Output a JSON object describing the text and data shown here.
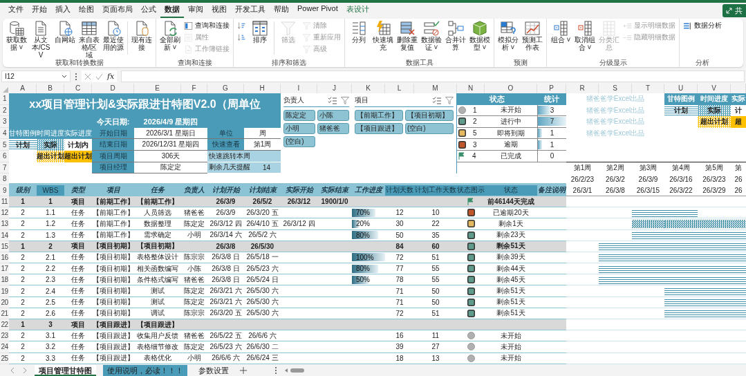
{
  "menu_tabs": [
    {
      "label": "文件",
      "selected": false,
      "kind": "standard"
    },
    {
      "label": "开始",
      "selected": false,
      "kind": "standard"
    },
    {
      "label": "插入",
      "selected": false,
      "kind": "standard"
    },
    {
      "label": "绘图",
      "selected": false,
      "kind": "standard"
    },
    {
      "label": "页面布局",
      "selected": false,
      "kind": "standard"
    },
    {
      "label": "公式",
      "selected": false,
      "kind": "standard"
    },
    {
      "label": "数据",
      "selected": true,
      "kind": "standard"
    },
    {
      "label": "审阅",
      "selected": false,
      "kind": "standard"
    },
    {
      "label": "视图",
      "selected": false,
      "kind": "standard"
    },
    {
      "label": "开发工具",
      "selected": false,
      "kind": "standard"
    },
    {
      "label": "帮助",
      "selected": false,
      "kind": "standard"
    },
    {
      "label": "Power Pivot",
      "selected": false,
      "kind": "standard"
    },
    {
      "label": "表设计",
      "selected": false,
      "kind": "contextual"
    }
  ],
  "share_button": {
    "label": "共"
  },
  "ribbon_groups": [
    {
      "label": "获取和转换数据",
      "items": [
        {
          "kind": "large",
          "label": "获取数据 ˅",
          "disabled": false
        },
        {
          "kind": "large",
          "label": "从文本/CSV",
          "disabled": false
        },
        {
          "kind": "large",
          "label": "自网站",
          "disabled": false
        },
        {
          "kind": "large",
          "label": "来自表格/区域",
          "disabled": false
        },
        {
          "kind": "large",
          "label": "最近使用的源",
          "disabled": false
        },
        {
          "kind": "divider"
        },
        {
          "kind": "large",
          "label": "现有连接",
          "disabled": false
        }
      ]
    },
    {
      "label": "查询和连接",
      "items": [
        {
          "kind": "large",
          "label": "全部刷新 ˅",
          "disabled": false
        },
        {
          "kind": "stack",
          "items": [
            {
              "label": "查询和连接",
              "disabled": false
            },
            {
              "label": "属性",
              "disabled": true
            },
            {
              "label": "工作簿链接",
              "disabled": true
            }
          ]
        }
      ]
    },
    {
      "label": "排序和筛选",
      "items": [
        {
          "kind": "stack",
          "items": [
            {
              "disabled": false
            },
            {
              "disabled": false
            }
          ]
        },
        {
          "kind": "large",
          "label": "排序",
          "disabled": false
        },
        {
          "kind": "divider"
        },
        {
          "kind": "large",
          "label": "筛选",
          "disabled": true
        },
        {
          "kind": "stack",
          "items": [
            {
              "label": "清除",
              "disabled": true
            },
            {
              "label": "重新应用",
              "disabled": true
            },
            {
              "label": "高级",
              "disabled": true
            }
          ]
        }
      ]
    },
    {
      "label": "数据工具",
      "items": [
        {
          "kind": "large",
          "label": "分列",
          "disabled": false
        },
        {
          "kind": "large",
          "label": "快速填充",
          "disabled": false
        },
        {
          "kind": "large",
          "label": "删除重复值",
          "disabled": false
        },
        {
          "kind": "large",
          "label": "数据验证 ˅",
          "disabled": false
        },
        {
          "kind": "large",
          "label": "合并计算",
          "disabled": false
        },
        {
          "kind": "large",
          "label": "数据模型 ˅",
          "disabled": false
        }
      ]
    },
    {
      "label": "预测",
      "items": [
        {
          "kind": "large",
          "label": "模拟分析 ˅",
          "disabled": false
        },
        {
          "kind": "large",
          "label": "预测工作表",
          "disabled": false
        }
      ]
    },
    {
      "label": "分级显示",
      "items": [
        {
          "kind": "large",
          "label": "组合 ˅",
          "disabled": false
        },
        {
          "kind": "large",
          "label": "取消组合 ˅",
          "disabled": false
        },
        {
          "kind": "large",
          "label": "分类汇总",
          "disabled": true
        },
        {
          "kind": "stack",
          "items": [
            {
              "label": "显示明细数据",
              "disabled": true
            },
            {
              "label": "隐藏明细数据",
              "disabled": true
            }
          ]
        }
      ]
    },
    {
      "label": "分析",
      "items": [
        {
          "kind": "stack",
          "items": [
            {
              "label": "数据分析",
              "disabled": false
            }
          ]
        }
      ]
    }
  ],
  "formula_bar": {
    "name_box": "I12",
    "function_label": "fx"
  },
  "column_headers": [
    "A",
    "B",
    "C",
    "D",
    "E",
    "F",
    "G",
    "H",
    "I",
    "J",
    "K",
    "L",
    "M",
    "N",
    "O",
    "P",
    "R",
    "S",
    "T",
    "U",
    "V"
  ],
  "row_numbers": [
    "1",
    "2",
    "3",
    "4",
    "5",
    "6",
    "7",
    "8",
    "9",
    "11",
    "12",
    "13",
    "14",
    "15",
    "16",
    "17",
    "18",
    "19",
    "20",
    "21",
    "22",
    "23",
    "24",
    "25"
  ],
  "title": "xx项目管理计划&实际跟进甘特图V2.0（周单位",
  "today_label": "今天日期:",
  "today": "2026/4/9 星期四",
  "legend_headers": [
    "甘特图例",
    "时间进度",
    "实际进度"
  ],
  "legend": [
    {
      "label": "计划",
      "kind": "plan"
    },
    {
      "label": "实际",
      "kind": "actual"
    },
    {
      "label": "计划内",
      "kind": "within"
    },
    {
      "label": "超出计划",
      "kind": "over-actual"
    },
    {
      "label": "超出计划",
      "kind": "over"
    }
  ],
  "project_info": [
    {
      "label": "开始日期",
      "value": "2026/3/1 星期日"
    },
    {
      "label": "结束日期",
      "value": "2026/12/31 星期四"
    },
    {
      "label": "项目周期",
      "value": "306天"
    },
    {
      "label": "项目经理",
      "value": "陈定定"
    }
  ],
  "settings": [
    {
      "label": "单位",
      "value": "周"
    },
    {
      "label": "快速查看",
      "value": "第1周"
    }
  ],
  "quick_jump": "快速跳转本周",
  "reminder": {
    "label": "剩余几天提醒",
    "value": "14"
  },
  "slicers": [
    {
      "title": "负责人",
      "buttons": [
        {
          "label": "陈定定",
          "selected": true
        },
        {
          "label": "小陈",
          "selected": true
        },
        {
          "label": "小明",
          "selected": true
        },
        {
          "label": "猪爸爸",
          "selected": true
        },
        {
          "label": "(空白)",
          "selected": true
        }
      ]
    },
    {
      "title": "项目",
      "buttons": [
        {
          "label": "【前期工作】",
          "selected": true
        },
        {
          "label": "【项目初期】",
          "selected": true
        },
        {
          "label": "【项目跟进】",
          "selected": true
        },
        {
          "label": "(空白)",
          "selected": true
        }
      ]
    }
  ],
  "status_panel": {
    "headers": [
      "状态",
      "统计"
    ],
    "rows": [
      {
        "kind": "not-started",
        "code": "1",
        "label": "未开始",
        "count": "3",
        "level": 0.43
      },
      {
        "kind": "in-progress",
        "code": "2",
        "label": "进行中",
        "count": "7",
        "level": 1
      },
      {
        "kind": "due-soon",
        "code": "5",
        "label": "即将到期",
        "count": "1",
        "level": 0.14
      },
      {
        "kind": "overdue",
        "code": "3",
        "label": "逾期",
        "count": "1",
        "level": 0.14
      },
      {
        "kind": "done",
        "code": "4",
        "label": "已完成",
        "count": "0"
      }
    ]
  },
  "credits": [
    "猪爸爸学Excel出品",
    "猪爸爸学Excel出品",
    "猪爸爸学Excel出品",
    "猪爸爸学Excel出品"
  ],
  "gantt_legend": {
    "headers": [
      "甘特图例",
      "时间进度",
      "实际"
    ],
    "cells": [
      {
        "label": "计划",
        "kind": "plan"
      },
      {
        "label": "实际",
        "kind": "actual"
      },
      {
        "label": "计",
        "kind": "within"
      },
      {
        "label": "超出计划",
        "kind": "over-actual"
      },
      {
        "label": "超",
        "kind": "over"
      }
    ]
  },
  "weeks": [
    "第1周",
    "第2周",
    "第3周",
    "第4周",
    "第5周",
    "第"
  ],
  "week_dates": [
    "26/2/23",
    "26/3/2",
    "26/3/9",
    "26/3/16",
    "26/3/23",
    "26"
  ],
  "table": {
    "headers": [
      {
        "text": "级别",
        "kind": "input"
      },
      {
        "text": "WBS",
        "kind": "computed"
      },
      {
        "text": "类型",
        "kind": "input"
      },
      {
        "text": "项目",
        "kind": "input"
      },
      {
        "text": "任务",
        "kind": "input"
      },
      {
        "text": "负责人",
        "kind": "input"
      },
      {
        "text": "计划开始",
        "kind": "input"
      },
      {
        "text": "计划结束",
        "kind": "input"
      },
      {
        "text": "实际开始",
        "kind": "input"
      },
      {
        "text": "实际结束",
        "kind": "input"
      },
      {
        "text": "工作进度",
        "kind": "input"
      },
      {
        "text": "计划天数",
        "kind": "computed"
      },
      {
        "text": "计划工作天数",
        "kind": "computed"
      },
      {
        "text": "状态图示",
        "kind": "computed"
      },
      {
        "text": "状态",
        "kind": "computed"
      },
      {
        "text": "备注说明",
        "kind": "input"
      }
    ],
    "gantt_dates": [
      "26/3/1",
      "26/3/8",
      "26/3/15",
      "26/3/22",
      "26/3/29",
      "26"
    ],
    "rows": [
      {
        "kind": "project",
        "tier": "1",
        "wbs": "1",
        "type": "项目",
        "project": "【前期工作】",
        "task": "【前期工作】",
        "plan_start": "26/3/9",
        "plan_end": "26/5/2",
        "actual_start": "26/3/12",
        "actual_end": "1900/1/0",
        "status_icon": {
          "kind": "done"
        },
        "status": "前46144天完成",
        "gantt": [
          {
            "kind": "none"
          },
          {
            "kind": "none"
          },
          {
            "kind": "none"
          },
          {
            "kind": "none"
          },
          {
            "kind": "none"
          },
          {
            "kind": "none"
          }
        ]
      },
      {
        "kind": "task",
        "tier": "2",
        "wbs": "1.1",
        "type": "任务",
        "project": "【前期工作】",
        "task": "人员筛选",
        "owner": "猪爸爸",
        "plan_start": "26/3/9",
        "plan_end": "26/3/20 五",
        "progress": {
          "text": "70%",
          "level": 0.7
        },
        "plan_days": "12",
        "work_days": "10",
        "status_icon": {
          "kind": "overdue"
        },
        "status": "已逾期20天",
        "gantt": [
          {
            "kind": "none"
          },
          {
            "kind": "none"
          },
          {
            "kind": "plan"
          },
          {
            "kind": "plan"
          },
          {
            "kind": "none"
          },
          {
            "kind": "none"
          }
        ]
      },
      {
        "kind": "task",
        "tier": "2",
        "wbs": "1.2",
        "type": "任务",
        "project": "【前期工作】",
        "task": "数据整理",
        "owner": "陈定定",
        "plan_start": "26/3/12 四",
        "plan_end": "26/4/10 五",
        "actual_start": "26/3/12 四",
        "progress": {
          "text": "20%",
          "level": 0.2
        },
        "plan_days": "30",
        "work_days": "22",
        "status_icon": {
          "kind": "due-soon"
        },
        "status": "剩余1天",
        "gantt": [
          {
            "kind": "none"
          },
          {
            "kind": "none"
          },
          {
            "kind": "actual"
          },
          {
            "kind": "actual"
          },
          {
            "kind": "actual"
          },
          {
            "kind": "actual"
          }
        ]
      },
      {
        "kind": "task",
        "tier": "2",
        "wbs": "1.3",
        "type": "任务",
        "project": "【前期工作】",
        "task": "需求确定",
        "owner": "小明",
        "plan_start": "26/3/14 六",
        "plan_end": "26/5/2 六",
        "progress": {
          "text": "80%",
          "level": 0.8
        },
        "plan_days": "50",
        "work_days": "35",
        "status_icon": {
          "kind": "in-progress"
        },
        "status": "剩余23天",
        "gantt": [
          {
            "kind": "none"
          },
          {
            "kind": "none"
          },
          {
            "kind": "plan"
          },
          {
            "kind": "plan"
          },
          {
            "kind": "plan"
          },
          {
            "kind": "plan"
          }
        ]
      },
      {
        "kind": "project",
        "tier": "1",
        "wbs": "2",
        "type": "项目",
        "project": "【项目初期】",
        "task": "【项目初期】",
        "plan_start": "26/3/8",
        "plan_end": "26/5/30",
        "plan_days": "84",
        "work_days": "60",
        "status_icon": {
          "kind": "in-progress"
        },
        "status": "剩余51天",
        "gantt": [
          {
            "kind": "none"
          },
          {
            "kind": "plan"
          },
          {
            "kind": "plan"
          },
          {
            "kind": "plan"
          },
          {
            "kind": "plan"
          },
          {
            "kind": "plan"
          }
        ]
      },
      {
        "kind": "task",
        "tier": "2",
        "wbs": "2.1",
        "type": "任务",
        "project": "【项目初期】",
        "task": "表格整体设计",
        "owner": "陈宗宗",
        "plan_start": "26/3/8 日",
        "plan_end": "26/5/18 一",
        "progress": {
          "text": "100%",
          "level": 1
        },
        "plan_days": "72",
        "work_days": "51",
        "status_icon": {
          "kind": "in-progress"
        },
        "status": "剩余39天",
        "gantt": [
          {
            "kind": "none"
          },
          {
            "kind": "plan"
          },
          {
            "kind": "plan"
          },
          {
            "kind": "plan"
          },
          {
            "kind": "plan"
          },
          {
            "kind": "plan"
          }
        ]
      },
      {
        "kind": "task",
        "tier": "2",
        "wbs": "2.2",
        "type": "任务",
        "project": "【项目初期】",
        "task": "相关函数编写",
        "owner": "小陈",
        "plan_start": "26/3/8 日",
        "plan_end": "26/5/23 六",
        "progress": {
          "text": "80%",
          "level": 0.8
        },
        "plan_days": "77",
        "work_days": "55",
        "status_icon": {
          "kind": "in-progress"
        },
        "status": "剩余44天",
        "gantt": [
          {
            "kind": "none"
          },
          {
            "kind": "plan"
          },
          {
            "kind": "plan"
          },
          {
            "kind": "plan"
          },
          {
            "kind": "plan"
          },
          {
            "kind": "plan"
          }
        ]
      },
      {
        "kind": "task",
        "tier": "2",
        "wbs": "2.3",
        "type": "任务",
        "project": "【项目初期】",
        "task": "条件格式编写",
        "owner": "猪爸爸",
        "plan_start": "26/3/8 日",
        "plan_end": "26/5/24 日",
        "progress": {
          "text": "50%",
          "level": 0.5
        },
        "plan_days": "78",
        "work_days": "55",
        "status_icon": {
          "kind": "in-progress"
        },
        "status": "剩余45天",
        "gantt": [
          {
            "kind": "none"
          },
          {
            "kind": "plan"
          },
          {
            "kind": "plan"
          },
          {
            "kind": "plan"
          },
          {
            "kind": "plan"
          },
          {
            "kind": "plan"
          }
        ]
      },
      {
        "kind": "task",
        "tier": "2",
        "wbs": "2.4",
        "type": "任务",
        "project": "【项目初期】",
        "task": "测试",
        "owner": "陈定定",
        "plan_start": "26/3/21 六",
        "plan_end": "26/5/30 六",
        "plan_days": "71",
        "work_days": "50",
        "status_icon": {
          "kind": "in-progress"
        },
        "status": "剩余51天",
        "gantt": [
          {
            "kind": "none"
          },
          {
            "kind": "none"
          },
          {
            "kind": "none"
          },
          {
            "kind": "plan"
          },
          {
            "kind": "plan"
          },
          {
            "kind": "plan"
          }
        ]
      },
      {
        "kind": "task",
        "tier": "2",
        "wbs": "2.5",
        "type": "任务",
        "project": "【项目初期】",
        "task": "测试",
        "owner": "陈定定",
        "plan_start": "26/3/21 六",
        "plan_end": "26/5/30 六",
        "plan_days": "71",
        "work_days": "50",
        "status_icon": {
          "kind": "in-progress"
        },
        "status": "剩余51天",
        "gantt": [
          {
            "kind": "none"
          },
          {
            "kind": "none"
          },
          {
            "kind": "none"
          },
          {
            "kind": "plan"
          },
          {
            "kind": "plan"
          },
          {
            "kind": "plan"
          }
        ]
      },
      {
        "kind": "task",
        "tier": "2",
        "wbs": "2.6",
        "type": "任务",
        "project": "【项目初期】",
        "task": "调试",
        "owner": "陈宗宗",
        "plan_start": "26/3/20 五",
        "plan_end": "26/5/30 六",
        "plan_days": "72",
        "work_days": "51",
        "status_icon": {
          "kind": "in-progress"
        },
        "status": "剩余51天",
        "gantt": [
          {
            "kind": "none"
          },
          {
            "kind": "none"
          },
          {
            "kind": "none"
          },
          {
            "kind": "plan"
          },
          {
            "kind": "plan"
          },
          {
            "kind": "plan"
          }
        ]
      },
      {
        "kind": "project",
        "tier": "1",
        "wbs": "3",
        "type": "项目",
        "project": "【项目跟进】",
        "task": "【项目跟进】",
        "gantt": [
          {
            "kind": "none"
          },
          {
            "kind": "none"
          },
          {
            "kind": "none"
          },
          {
            "kind": "none"
          },
          {
            "kind": "none"
          },
          {
            "kind": "none"
          }
        ]
      },
      {
        "kind": "task",
        "tier": "2",
        "wbs": "3.1",
        "type": "任务",
        "project": "【项目跟进】",
        "task": "收集用户反馈",
        "owner": "猪爸爸",
        "plan_start": "26/5/22 五",
        "plan_end": "26/6/6 六",
        "plan_days": "16",
        "work_days": "11",
        "status_icon": {
          "kind": "not-started"
        },
        "status": "未开始",
        "gantt": [
          {
            "kind": "none"
          },
          {
            "kind": "none"
          },
          {
            "kind": "none"
          },
          {
            "kind": "none"
          },
          {
            "kind": "none"
          },
          {
            "kind": "none"
          }
        ]
      },
      {
        "kind": "task",
        "tier": "2",
        "wbs": "3.2",
        "type": "任务",
        "project": "【项目跟进】",
        "task": "表格细节修改",
        "owner": "陈定定",
        "plan_start": "26/5/23 六",
        "plan_end": "26/6/30 二",
        "plan_days": "39",
        "work_days": "27",
        "status_icon": {
          "kind": "not-started"
        },
        "status": "未开始",
        "gantt": [
          {
            "kind": "none"
          },
          {
            "kind": "none"
          },
          {
            "kind": "none"
          },
          {
            "kind": "none"
          },
          {
            "kind": "none"
          },
          {
            "kind": "none"
          }
        ]
      },
      {
        "kind": "task",
        "tier": "2",
        "wbs": "3.3",
        "type": "任务",
        "project": "【项目跟进】",
        "task": "表格优化",
        "owner": "小明",
        "plan_start": "26/6/6 六",
        "plan_end": "26/6/24 三",
        "plan_days": "18",
        "work_days": "13",
        "status_icon": {
          "kind": "not-started"
        },
        "status": "未开始",
        "gantt": [
          {
            "kind": "none"
          },
          {
            "kind": "none"
          },
          {
            "kind": "none"
          },
          {
            "kind": "none"
          },
          {
            "kind": "none"
          },
          {
            "kind": "none"
          }
        ]
      }
    ]
  },
  "sheet_tabs": [
    {
      "label": "项目管理甘特图",
      "selected": true
    },
    {
      "label": "使用说明，必读！！！",
      "selected": false,
      "color": "#4a9bb8"
    },
    {
      "label": "参数设置",
      "selected": false
    }
  ]
}
